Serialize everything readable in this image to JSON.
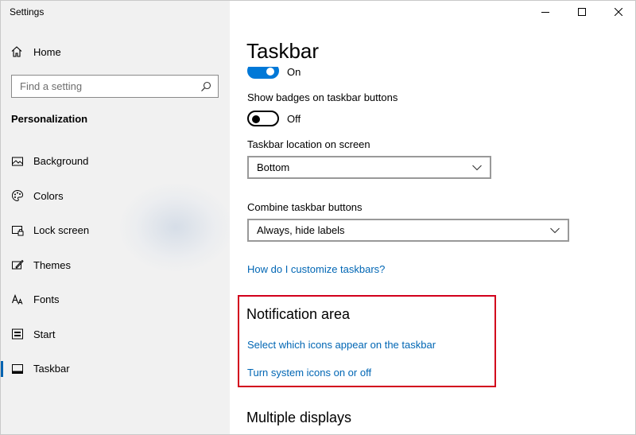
{
  "window": {
    "app_title": "Settings"
  },
  "sidebar": {
    "home_label": "Home",
    "search_placeholder": "Find a setting",
    "section_title": "Personalization",
    "items": [
      {
        "label": "Background",
        "icon": "picture-icon"
      },
      {
        "label": "Colors",
        "icon": "palette-icon"
      },
      {
        "label": "Lock screen",
        "icon": "lock-screen-icon"
      },
      {
        "label": "Themes",
        "icon": "themes-icon"
      },
      {
        "label": "Fonts",
        "icon": "fonts-icon"
      },
      {
        "label": "Start",
        "icon": "start-icon"
      },
      {
        "label": "Taskbar",
        "icon": "taskbar-icon",
        "active": true
      }
    ]
  },
  "main": {
    "title": "Taskbar",
    "toggle1_state": "On",
    "badges_label": "Show badges on taskbar buttons",
    "badges_state": "Off",
    "location_label": "Taskbar location on screen",
    "location_value": "Bottom",
    "combine_label": "Combine taskbar buttons",
    "combine_value": "Always, hide labels",
    "customize_link": "How do I customize taskbars?",
    "notification_heading": "Notification area",
    "notification_link1": "Select which icons appear on the taskbar",
    "notification_link2": "Turn system icons on or off",
    "multiple_displays_heading": "Multiple displays"
  },
  "colors": {
    "accent": "#0078d7",
    "link": "#0066b4",
    "highlight_border": "#d2001c",
    "sidebar_bg": "#f1f1f1"
  }
}
